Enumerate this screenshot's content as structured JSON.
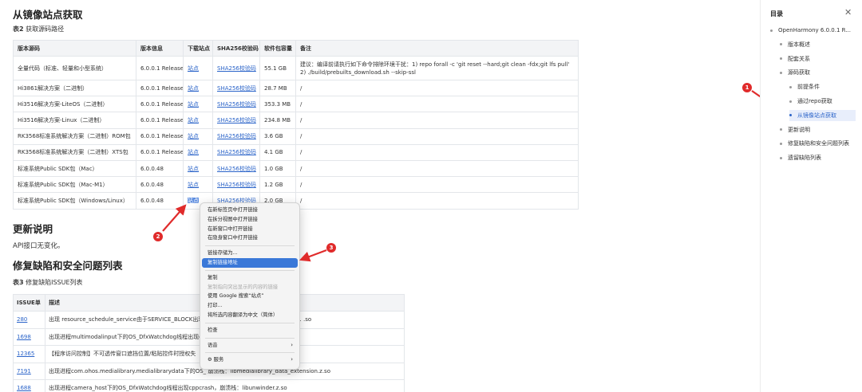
{
  "section_mirror": {
    "title": "从镜像站点获取",
    "table_caption_num": "表2",
    "table_caption_text": "获取源码路径"
  },
  "source_table": {
    "headers": [
      "版本源码",
      "版本信息",
      "下载站点",
      "SHA256校验码",
      "软件包容量",
      "备注"
    ],
    "rows": [
      {
        "name": "全量代码（标准、轻量和小型系统）",
        "version": "6.0.0.1 Release",
        "site": "站点",
        "sha": "SHA256校验码",
        "size": "55.1 GB",
        "note": "建议：编译前请执行如下命令排除环境干扰：1) repo forall -c 'git reset --hard;git clean -fdx;git lfs pull' 2) ./build/prebuilts_download.sh --skip-ssl"
      },
      {
        "name": "Hi3861解决方案（二进制）",
        "version": "6.0.0.1 Release",
        "site": "站点",
        "sha": "SHA256校验码",
        "size": "28.7 MB",
        "note": "/"
      },
      {
        "name": "Hi3516解决方案-LiteOS（二进制）",
        "version": "6.0.0.1 Release",
        "site": "站点",
        "sha": "SHA256校验码",
        "size": "353.3 MB",
        "note": "/"
      },
      {
        "name": "Hi3516解决方案-Linux（二进制）",
        "version": "6.0.0.1 Release",
        "site": "站点",
        "sha": "SHA256校验码",
        "size": "234.8 MB",
        "note": "/"
      },
      {
        "name": "RK3568标准系统解决方案（二进制）ROM包",
        "version": "6.0.0.1 Release",
        "site": "站点",
        "sha": "SHA256校验码",
        "size": "3.6 GB",
        "note": "/"
      },
      {
        "name": "RK3568标准系统解决方案（二进制）XTS包",
        "version": "6.0.0.1 Release",
        "site": "站点",
        "sha": "SHA256校验码",
        "size": "4.1 GB",
        "note": "/"
      },
      {
        "name": "标准系统Public SDK包（Mac）",
        "version": "6.0.0.48",
        "site": "站点",
        "sha": "SHA256校验码",
        "size": "1.0 GB",
        "note": "/"
      },
      {
        "name": "标准系统Public SDK包（Mac-M1）",
        "version": "6.0.0.48",
        "site": "站点",
        "sha": "SHA256校验码",
        "size": "1.2 GB",
        "note": "/"
      },
      {
        "name": "标准系统Public SDK包（Windows/Linux）",
        "version": "6.0.0.48",
        "site": "站点",
        "sha": "SHA256校验码",
        "size": "2.0 GB",
        "note": "/"
      }
    ]
  },
  "section_update": {
    "title": "更新说明",
    "text": "API接口无变化。"
  },
  "section_fix": {
    "title": "修复缺陷和安全问题列表",
    "table_caption_num": "表3",
    "table_caption_text": "修复缺陷ISSUE列表"
  },
  "issue_table": {
    "headers": [
      "ISSUE单",
      "描述"
    ],
    "rows": [
      {
        "id": "280",
        "desc": "出现 resource_schedule_service由于SERVICE_BLOCK出现 ...................................................... .so"
      },
      {
        "id": "1698",
        "desc": "出现进程multimodalinput下的OS_DfxWatchdog线程出现c"
      },
      {
        "id": "12365",
        "desc": "【程序访问控制】不可透传窗口遮挡位置/粘贴控件时授权失"
      },
      {
        "id": "7191",
        "desc": "出现进程com.ohos.medialibrary.medialibrarydata下的OS_               崩溃栈：libmedialibrary_data_extension.z.so"
      },
      {
        "id": "1688",
        "desc": "出现进程camera_host下的OS_DfxWatchdog线程出现cppcrash，崩溃栈：libunwinder.z.so"
      }
    ]
  },
  "context_menu": {
    "items": [
      {
        "label": "在新标签页中打开链接",
        "state": "normal"
      },
      {
        "label": "在拆分视图中打开链接",
        "state": "normal"
      },
      {
        "label": "在新窗口中打开链接",
        "state": "normal"
      },
      {
        "label": "在隐身窗口中打开链接",
        "state": "normal"
      },
      {
        "sep": true
      },
      {
        "label": "链接存储为...",
        "state": "normal"
      },
      {
        "label": "复制链接地址",
        "state": "highlight"
      },
      {
        "sep": true
      },
      {
        "label": "复制",
        "state": "normal"
      },
      {
        "label": "复制指向突出显示的内容的链接",
        "state": "disabled"
      },
      {
        "label": "使用 Google 搜索“站点”",
        "state": "normal"
      },
      {
        "label": "打印...",
        "state": "normal"
      },
      {
        "label": "将所选内容翻译为中文（简体）",
        "state": "normal"
      },
      {
        "sep": true
      },
      {
        "label": "检查",
        "state": "normal"
      },
      {
        "sep": true
      },
      {
        "label": "语音",
        "state": "normal",
        "submenu": "›"
      },
      {
        "sep": true
      },
      {
        "label": "服务",
        "state": "normal",
        "submenu": "›",
        "icon": "⚙"
      }
    ]
  },
  "annotations": {
    "b1": "1",
    "b2": "2",
    "b3": "3",
    "color": "#e02b2b"
  },
  "toc": {
    "title": "目录",
    "close": "✕",
    "items": [
      {
        "label": "OpenHarmony 6.0.0.1 R...",
        "level": 0
      },
      {
        "label": "版本概述",
        "level": 1
      },
      {
        "label": "配套关系",
        "level": 1
      },
      {
        "label": "源码获取",
        "level": 1
      },
      {
        "label": "前提条件",
        "level": 2
      },
      {
        "label": "通过repo获取",
        "level": 2
      },
      {
        "label": "从镜像站点获取",
        "level": 2,
        "active": true
      },
      {
        "label": "更新说明",
        "level": 1
      },
      {
        "label": "修复缺陷和安全问题列表",
        "level": 1
      },
      {
        "label": "遗留缺陷列表",
        "level": 1
      }
    ]
  }
}
